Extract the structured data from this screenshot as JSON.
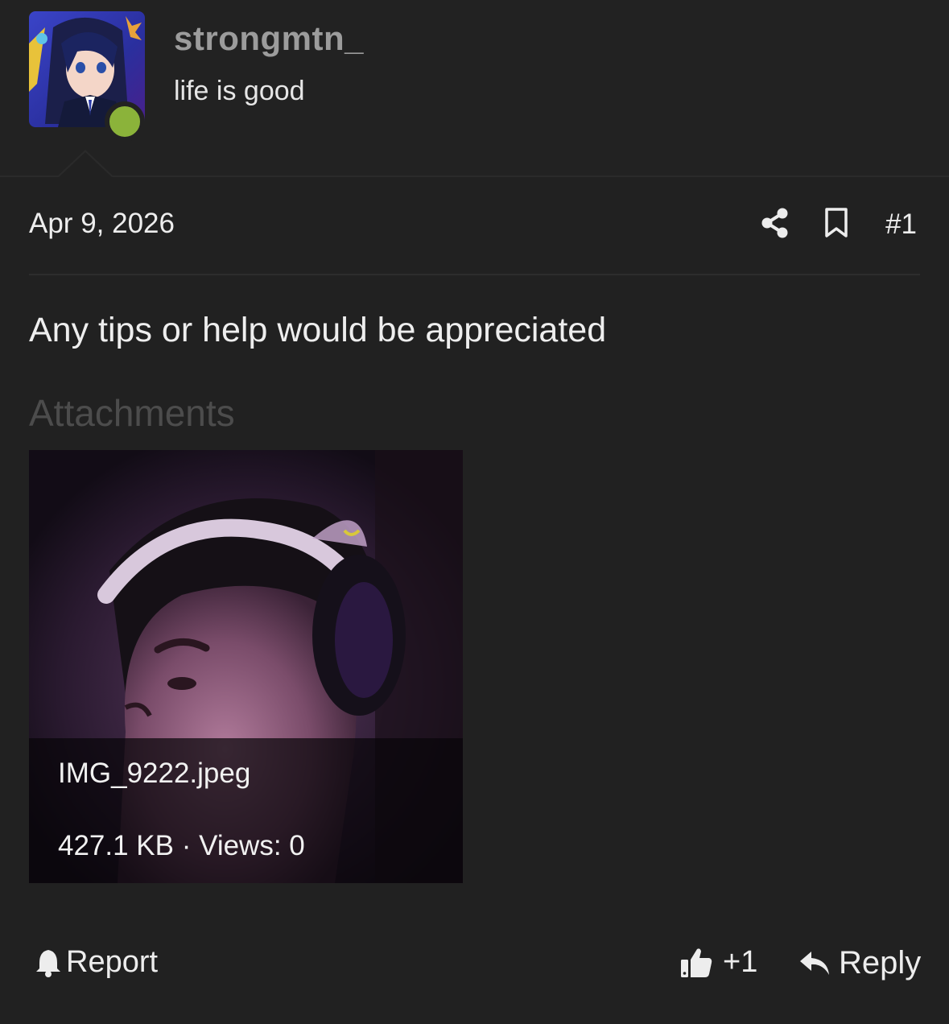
{
  "user": {
    "username": "strongmtn_",
    "title": "life is good",
    "online_color": "#8bb33a",
    "avatar_icon": "anime-avatar"
  },
  "post": {
    "date": "Apr 9, 2026",
    "number": "#1",
    "message": "Any tips or help would be appreciated",
    "actions": {
      "share_icon": "share-icon",
      "bookmark_icon": "bookmark-icon"
    }
  },
  "attachments": {
    "heading": "Attachments",
    "items": [
      {
        "filename": "IMG_9222.jpeg",
        "meta": "427.1 KB · Views: 0"
      }
    ]
  },
  "footer": {
    "report_label": "Report",
    "like_label": "+1",
    "reply_label": "Reply"
  }
}
